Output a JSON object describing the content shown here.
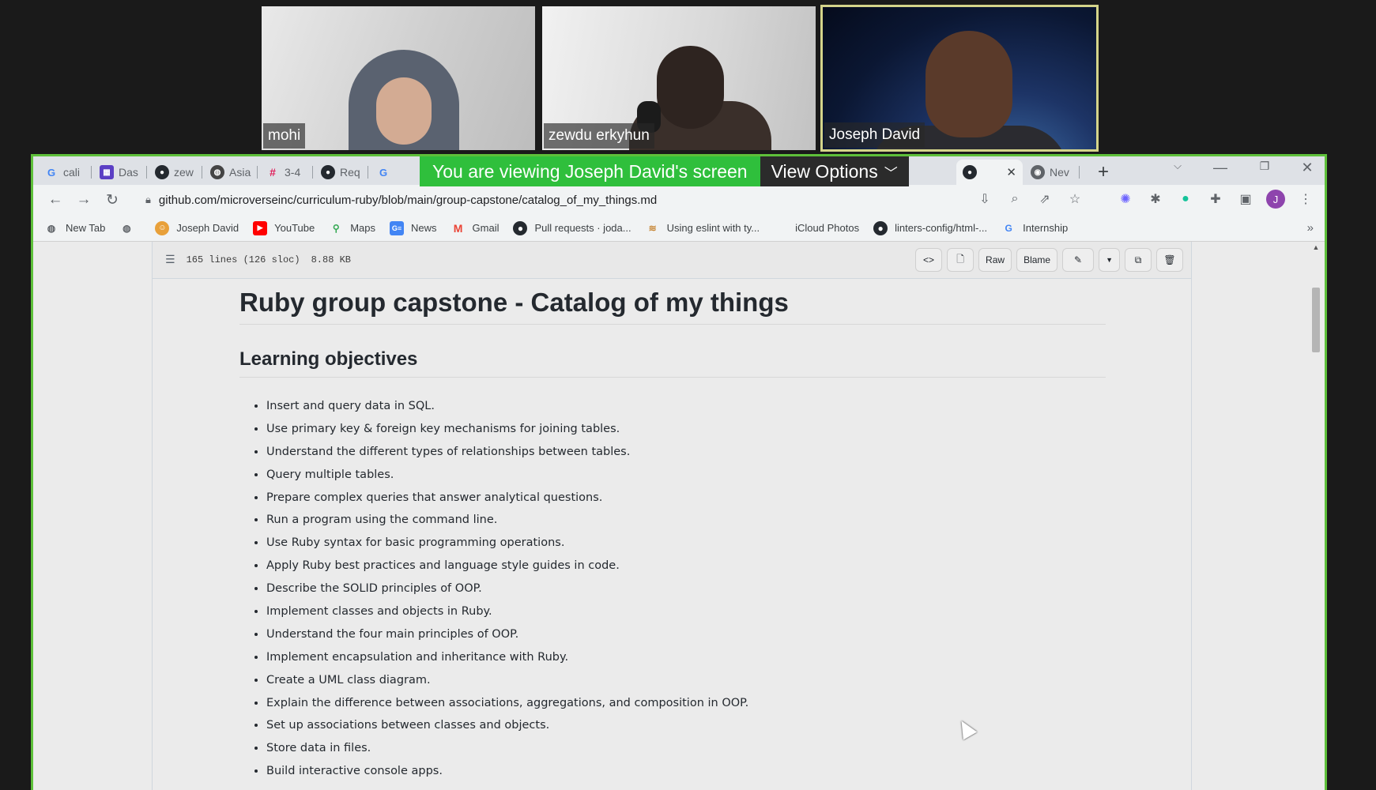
{
  "participants": [
    {
      "name": "mohi"
    },
    {
      "name": "zewdu erkyhun"
    },
    {
      "name": "Joseph David"
    }
  ],
  "zoom_banner": {
    "message": "You are viewing Joseph David's screen",
    "options_label": "View Options"
  },
  "tabs": [
    {
      "label": "cali",
      "icon": "google-icon"
    },
    {
      "label": "Das",
      "icon": "dashboard-icon"
    },
    {
      "label": "zew",
      "icon": "github-icon"
    },
    {
      "label": "Asia",
      "icon": "globe-icon"
    },
    {
      "label": "3-4",
      "icon": "slack-icon"
    },
    {
      "label": "Req",
      "icon": "github-icon"
    },
    {
      "label": "",
      "icon": "google-icon"
    },
    {
      "label": "",
      "icon": "github-icon"
    },
    {
      "label": "Nev",
      "icon": "chrome-icon"
    }
  ],
  "toolbar": {
    "url": "github.com/microverseinc/curriculum-ruby/blob/main/group-capstone/catalog_of_my_things.md",
    "avatar_letter": "J"
  },
  "bookmarks": [
    {
      "label": "New Tab"
    },
    {
      "label": ""
    },
    {
      "label": "Joseph David"
    },
    {
      "label": "YouTube"
    },
    {
      "label": "Maps"
    },
    {
      "label": "News"
    },
    {
      "label": "Gmail"
    },
    {
      "label": "Pull requests · joda..."
    },
    {
      "label": "Using eslint with ty..."
    },
    {
      "label": "iCloud Photos"
    },
    {
      "label": "linters-config/html-..."
    },
    {
      "label": "Internship"
    }
  ],
  "file_header": {
    "lines": "165 lines (126 sloc)",
    "size": "8.88 KB",
    "raw_label": "Raw",
    "blame_label": "Blame"
  },
  "markdown": {
    "title": "Ruby group capstone - Catalog of my things",
    "section_heading": "Learning objectives",
    "objectives": [
      "Insert and query data in SQL.",
      "Use primary key & foreign key mechanisms for joining tables.",
      "Understand the different types of relationships between tables.",
      "Query multiple tables.",
      "Prepare complex queries that answer analytical questions.",
      "Run a program using the command line.",
      "Use Ruby syntax for basic programming operations.",
      "Apply Ruby best practices and language style guides in code.",
      "Describe the SOLID principles of OOP.",
      "Implement classes and objects in Ruby.",
      "Understand the four main principles of OOP.",
      "Implement encapsulation and inheritance with Ruby.",
      "Create a UML class diagram.",
      "Explain the difference between associations, aggregations, and composition in OOP.",
      "Set up associations between classes and objects.",
      "Store data in files.",
      "Build interactive console apps."
    ]
  },
  "colors": {
    "zoom_green": "#2fbf3c",
    "screen_border": "#5ec03a",
    "active_speaker": "#d4d48a"
  }
}
